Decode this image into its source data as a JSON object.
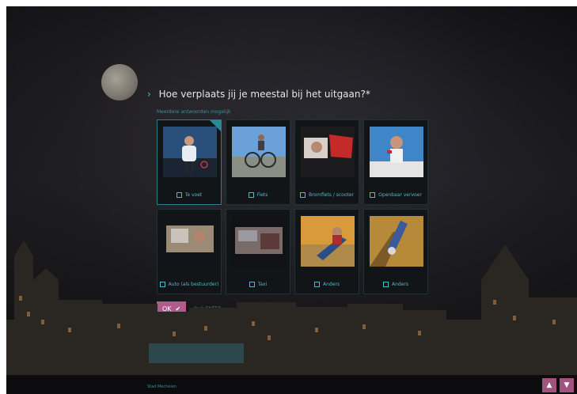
{
  "survey": {
    "question": "Hoe verplaats jij je meestal bij het uitgaan?*",
    "question_bullet": "›",
    "instruction": "Meerdere antwoorden mogelijk",
    "options": [
      {
        "label": "Te voet",
        "selected": true,
        "image": "person-standing-photo"
      },
      {
        "label": "Fiets",
        "selected": false,
        "image": "bicycle-photo"
      },
      {
        "label": "Bromfiets / scooter",
        "selected": false,
        "image": "scooter-photo"
      },
      {
        "label": "Openbaar vervoer",
        "selected": false,
        "image": "public-transport-photo"
      },
      {
        "label": "Auto (als bestuurder)",
        "selected": false,
        "image": "car-driver-photo"
      },
      {
        "label": "Taxi",
        "selected": false,
        "image": "taxi-photo"
      },
      {
        "label": "Anders",
        "selected": false,
        "image": "relaxing-photo"
      },
      {
        "label": "Anders",
        "selected": false,
        "image": "other-photo"
      }
    ],
    "ok_label": "OK",
    "ok_icon": "checkmark-icon",
    "hint": "druk ENTER"
  },
  "footer": {
    "line1": "Stad Mechelen",
    "line2": "",
    "nav_up": "▲",
    "nav_down": "▼"
  },
  "colors": {
    "accent": "#56b6c6",
    "button": "#b05b8a",
    "background": "#121214"
  }
}
